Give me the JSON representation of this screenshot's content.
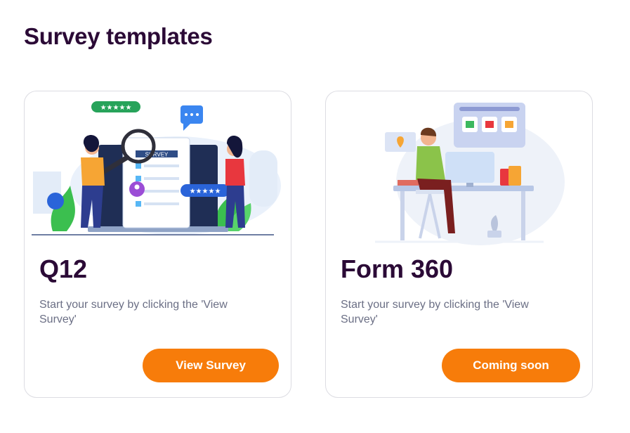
{
  "page": {
    "title": "Survey templates"
  },
  "cards": [
    {
      "title": "Q12",
      "description": "Start your survey by clicking the 'View Survey'",
      "button_label": "View Survey",
      "illustration_label": "SURVEY",
      "illustration": "survey-illustration"
    },
    {
      "title": "Form 360",
      "description": "Start your survey by clicking the 'View Survey'",
      "button_label": "Coming soon",
      "illustration": "online-shopping-illustration"
    }
  ],
  "colors": {
    "title": "#2b0a36",
    "description": "#6b6f85",
    "button": "#f77c0a",
    "card_border": "#dcdce2"
  }
}
